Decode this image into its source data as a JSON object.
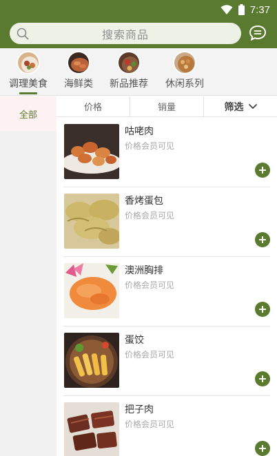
{
  "status_bar": {
    "time": "7:37"
  },
  "search": {
    "placeholder": "搜索商品"
  },
  "colors": {
    "brand": "#5a7a2f",
    "active_nav_bg": "#fdf1f1"
  },
  "categories": [
    {
      "label": "调理美食",
      "icon": "food-plate-icon",
      "active": true
    },
    {
      "label": "海鲜类",
      "icon": "seafood-plate-icon",
      "active": false
    },
    {
      "label": "新品推荐",
      "icon": "new-dish-icon",
      "active": false
    },
    {
      "label": "休闲系列",
      "icon": "snack-plate-icon",
      "active": false
    }
  ],
  "side_nav": [
    {
      "label": "全部",
      "active": true
    }
  ],
  "sort_bar": {
    "price": "价格",
    "sales": "销量",
    "filter": "筛选"
  },
  "products": [
    {
      "name": "咕咾肉",
      "price_text": "价格会员可见",
      "image": "sweet-sour-pork"
    },
    {
      "name": "香烤蛋包",
      "price_text": "价格会员可见",
      "image": "baked-egg-dumplings"
    },
    {
      "name": "澳洲胸排",
      "price_text": "价格会员可见",
      "image": "australian-chicken-breast"
    },
    {
      "name": "蛋饺",
      "price_text": "价格会员可见",
      "image": "egg-dumplings-hotpot"
    },
    {
      "name": "把子肉",
      "price_text": "价格会员可见",
      "image": "braised-pork-belly"
    }
  ]
}
